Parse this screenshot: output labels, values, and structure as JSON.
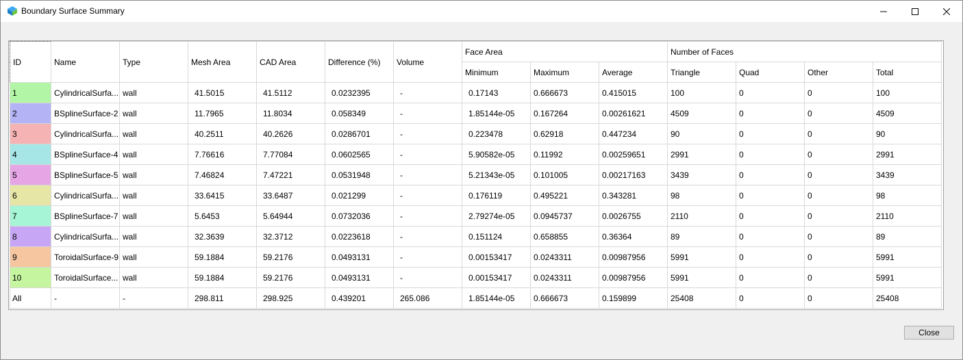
{
  "window": {
    "title": "Boundary Surface Summary"
  },
  "table": {
    "headers": {
      "id": "ID",
      "name": "Name",
      "type": "Type",
      "mesh_area": "Mesh Area",
      "cad_area": "CAD Area",
      "difference": "Difference (%)",
      "volume": "Volume",
      "face_area": "Face Area",
      "number_of_faces": "Number of Faces",
      "minimum": "Minimum",
      "maximum": "Maximum",
      "average": "Average",
      "triangle": "Triangle",
      "quad": "Quad",
      "other": "Other",
      "total": "Total"
    },
    "rows": [
      {
        "id": "1",
        "color": "#b3f5a6",
        "name": "CylindricalSurfa...",
        "type": "wall",
        "mesh_area": "41.5015",
        "cad_area": "41.5112",
        "difference": "0.0232395",
        "volume": "-",
        "min": "0.17143",
        "max": "0.666673",
        "avg": "0.415015",
        "triangle": "100",
        "quad": "0",
        "other": "0",
        "total": "100"
      },
      {
        "id": "2",
        "color": "#b3b3f5",
        "name": "BSplineSurface-2",
        "type": "wall",
        "mesh_area": "11.7965",
        "cad_area": "11.8034",
        "difference": "0.058349",
        "volume": "-",
        "min": "1.85144e-05",
        "max": "0.167264",
        "avg": "0.00261621",
        "triangle": "4509",
        "quad": "0",
        "other": "0",
        "total": "4509"
      },
      {
        "id": "3",
        "color": "#f5b3b3",
        "name": "CylindricalSurfa...",
        "type": "wall",
        "mesh_area": "40.2511",
        "cad_area": "40.2626",
        "difference": "0.0286701",
        "volume": "-",
        "min": "0.223478",
        "max": "0.62918",
        "avg": "0.447234",
        "triangle": "90",
        "quad": "0",
        "other": "0",
        "total": "90"
      },
      {
        "id": "4",
        "color": "#a6e6e6",
        "name": "BSplineSurface-4",
        "type": "wall",
        "mesh_area": "7.76616",
        "cad_area": "7.77084",
        "difference": "0.0602565",
        "volume": "-",
        "min": "5.90582e-05",
        "max": "0.11992",
        "avg": "0.00259651",
        "triangle": "2991",
        "quad": "0",
        "other": "0",
        "total": "2991"
      },
      {
        "id": "5",
        "color": "#e6a6e6",
        "name": "BSplineSurface-5",
        "type": "wall",
        "mesh_area": "7.46824",
        "cad_area": "7.47221",
        "difference": "0.0531948",
        "volume": "-",
        "min": "5.21343e-05",
        "max": "0.101005",
        "avg": "0.00217163",
        "triangle": "3439",
        "quad": "0",
        "other": "0",
        "total": "3439"
      },
      {
        "id": "6",
        "color": "#e6e6a6",
        "name": "CylindricalSurfa...",
        "type": "wall",
        "mesh_area": "33.6415",
        "cad_area": "33.6487",
        "difference": "0.021299",
        "volume": "-",
        "min": "0.176119",
        "max": "0.495221",
        "avg": "0.343281",
        "triangle": "98",
        "quad": "0",
        "other": "0",
        "total": "98"
      },
      {
        "id": "7",
        "color": "#a6f5d6",
        "name": "BSplineSurface-7",
        "type": "wall",
        "mesh_area": "5.6453",
        "cad_area": "5.64944",
        "difference": "0.0732036",
        "volume": "-",
        "min": "2.79274e-05",
        "max": "0.0945737",
        "avg": "0.0026755",
        "triangle": "2110",
        "quad": "0",
        "other": "0",
        "total": "2110"
      },
      {
        "id": "8",
        "color": "#c6a6f5",
        "name": "CylindricalSurfa...",
        "type": "wall",
        "mesh_area": "32.3639",
        "cad_area": "32.3712",
        "difference": "0.0223618",
        "volume": "-",
        "min": "0.151124",
        "max": "0.658855",
        "avg": "0.36364",
        "triangle": "89",
        "quad": "0",
        "other": "0",
        "total": "89"
      },
      {
        "id": "9",
        "color": "#f5c6a0",
        "name": "ToroidalSurface-9",
        "type": "wall",
        "mesh_area": "59.1884",
        "cad_area": "59.2176",
        "difference": "0.0493131",
        "volume": "-",
        "min": "0.00153417",
        "max": "0.0243311",
        "avg": "0.00987956",
        "triangle": "5991",
        "quad": "0",
        "other": "0",
        "total": "5991"
      },
      {
        "id": "10",
        "color": "#c6f5a0",
        "name": "ToroidalSurface...",
        "type": "wall",
        "mesh_area": "59.1884",
        "cad_area": "59.2176",
        "difference": "0.0493131",
        "volume": "-",
        "min": "0.00153417",
        "max": "0.0243311",
        "avg": "0.00987956",
        "triangle": "5991",
        "quad": "0",
        "other": "0",
        "total": "5991"
      },
      {
        "id": "All",
        "color": "#ffffff",
        "name": "-",
        "type": "-",
        "mesh_area": "298.811",
        "cad_area": "298.925",
        "difference": "0.439201",
        "volume": "265.086",
        "min": "1.85144e-05",
        "max": "0.666673",
        "avg": "0.159899",
        "triangle": "25408",
        "quad": "0",
        "other": "0",
        "total": "25408"
      }
    ]
  },
  "footer": {
    "close_label": "Close"
  }
}
